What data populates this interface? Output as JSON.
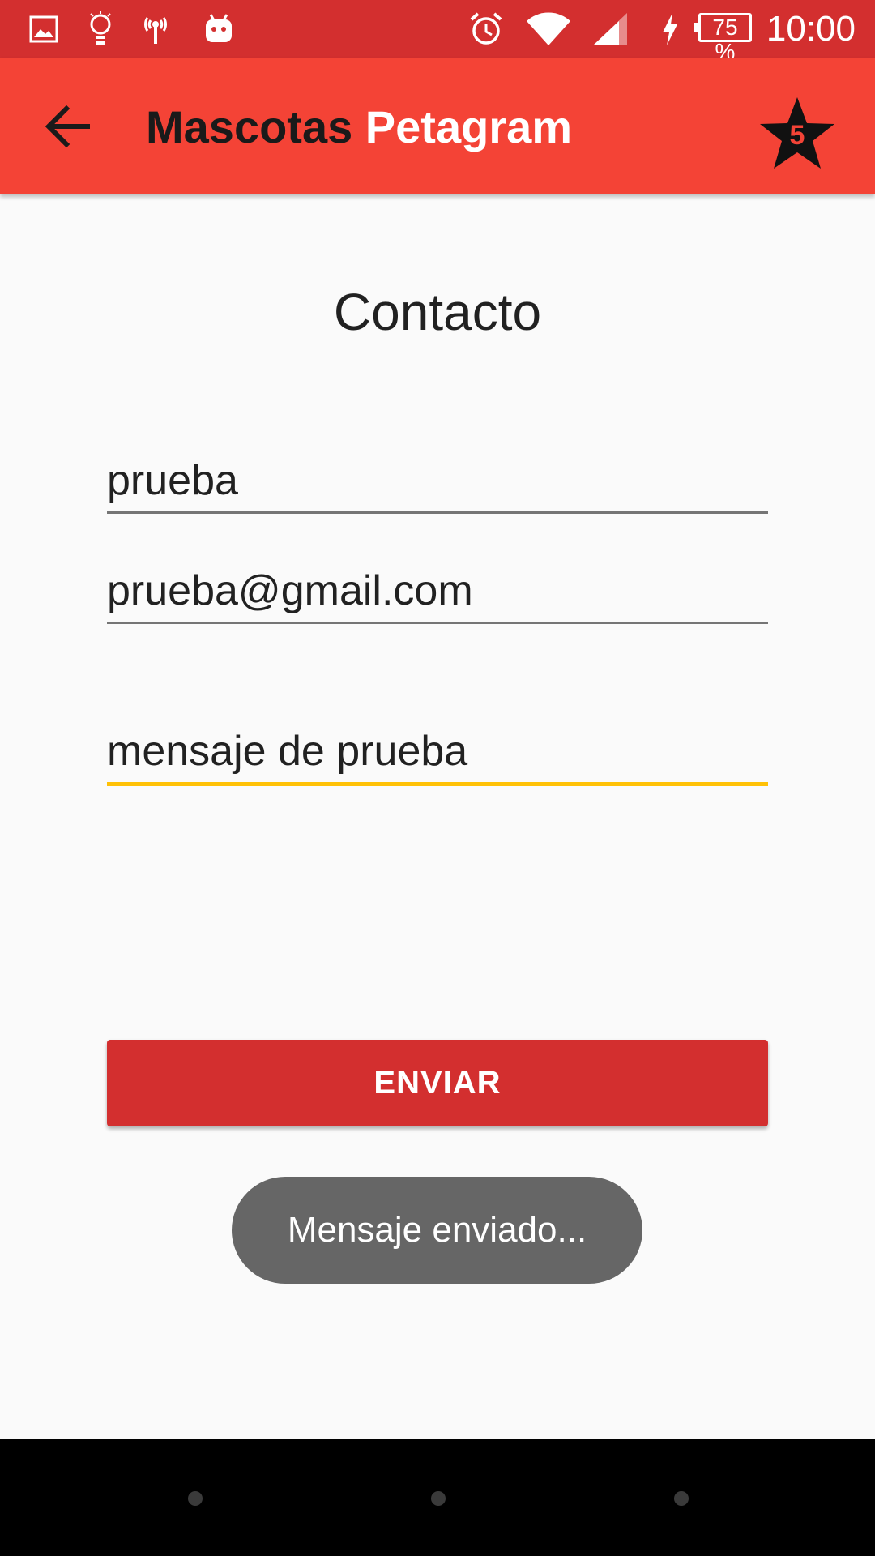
{
  "status_bar": {
    "time": "10:00",
    "battery": "75 %",
    "icons": [
      "image-icon",
      "lightbulb-icon",
      "hotspot-icon",
      "android-icon",
      "alarm-icon",
      "wifi-icon",
      "signal-icon",
      "charging-icon"
    ]
  },
  "app_bar": {
    "title_part1": "Mascotas",
    "title_part2": "Petagram",
    "favorites_count": "5",
    "color": "#f44336"
  },
  "contact": {
    "heading": "Contacto",
    "name_value": "prueba",
    "email_value": "prueba@gmail.com",
    "message_value": "mensaje de prueba",
    "send_label": "ENVIAR"
  },
  "toast": {
    "text": "Mensaje enviado..."
  },
  "colors": {
    "status_bar": "#d32f2f",
    "accent": "#ffc107",
    "button": "#d32f2f"
  }
}
